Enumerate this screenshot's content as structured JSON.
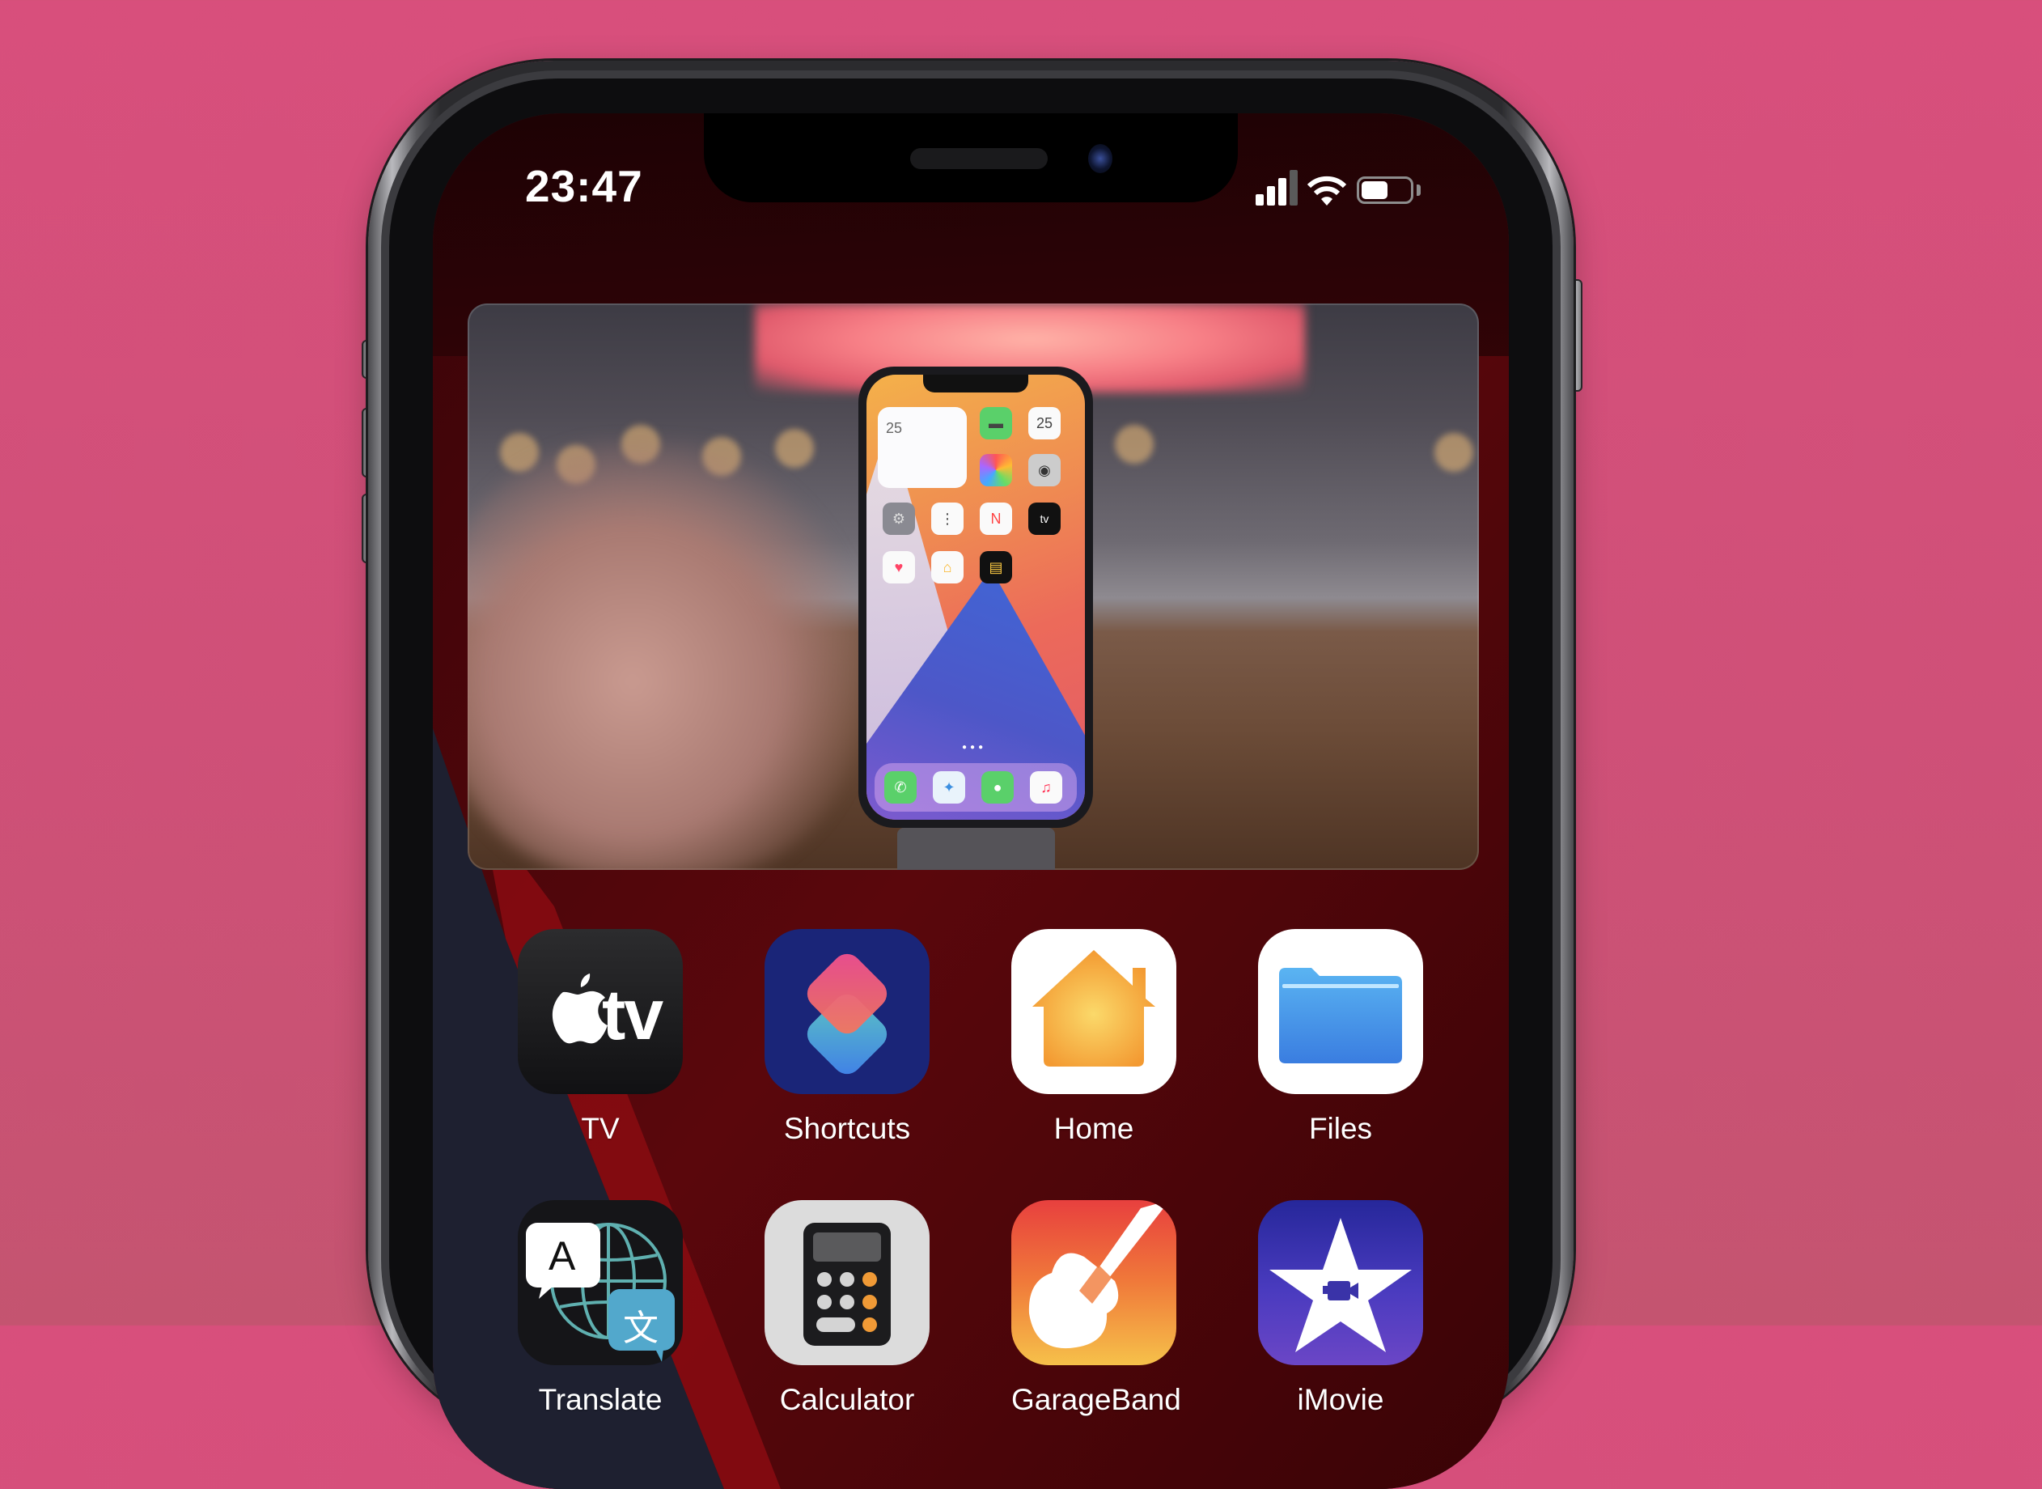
{
  "background_color": "#d84f7c",
  "status_bar": {
    "time": "23:47",
    "signal_bars_filled": 3,
    "signal_bars_total": 4,
    "wifi_icon": "wifi-icon",
    "battery_level_percent": 55
  },
  "pip_video": {
    "description": "Picture-in-Picture video of a hand presenting an iPhone on a stand",
    "inner_phone": {
      "widget_date": "25",
      "calendar_date": "25",
      "apps": [
        "FaceTime",
        "Calendar",
        "Photos",
        "Camera",
        "Settings",
        "Reminders",
        "News",
        "TV",
        "Health",
        "Home",
        "Wallet"
      ],
      "dock": [
        "Phone",
        "Safari",
        "Messages",
        "Music"
      ],
      "tv_glyph": "tv"
    }
  },
  "apps_row1": [
    {
      "label": "TV",
      "icon": "apple-tv-icon",
      "glyph": "tv"
    },
    {
      "label": "Shortcuts",
      "icon": "shortcuts-icon"
    },
    {
      "label": "Home",
      "icon": "home-icon"
    },
    {
      "label": "Files",
      "icon": "files-folder-icon"
    }
  ],
  "apps_row2": [
    {
      "label": "Translate",
      "icon": "translate-icon",
      "glyph_a": "A",
      "glyph_b": "文"
    },
    {
      "label": "Calculator",
      "icon": "calculator-icon"
    },
    {
      "label": "GarageBand",
      "icon": "garageband-guitar-icon"
    },
    {
      "label": "iMovie",
      "icon": "imovie-star-icon"
    }
  ]
}
